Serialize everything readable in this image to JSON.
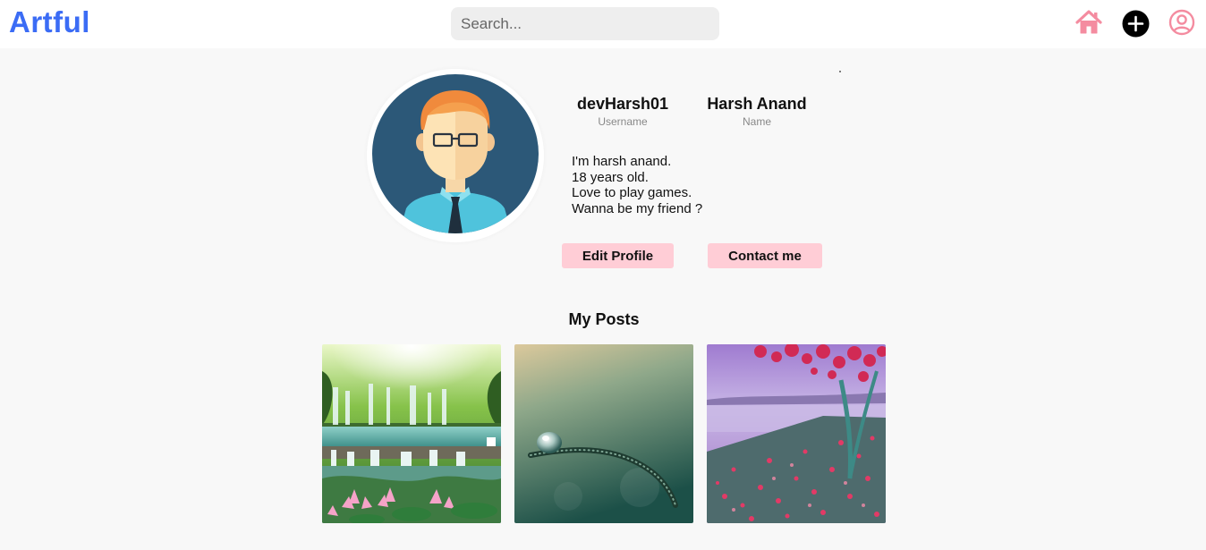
{
  "brand": {
    "name": "Artful",
    "color": "#3b6cf5"
  },
  "search": {
    "placeholder": "Search..."
  },
  "nav": {
    "icons": [
      "home-icon",
      "add-post-icon",
      "profile-icon"
    ],
    "accent": "#f48ca0"
  },
  "profile": {
    "username": "devHarsh01",
    "username_caption": "Username",
    "name": "Harsh Anand",
    "name_caption": "Name",
    "bio": [
      "I'm harsh anand.",
      "18 years old.",
      "Love to play games.",
      "Wanna be my friend ?"
    ],
    "avatar": "avatar-man-with-glasses"
  },
  "actions": {
    "edit_label": "Edit Profile",
    "contact_label": "Contact me",
    "button_color": "#ffcdd6"
  },
  "posts": {
    "title": "My Posts",
    "items": [
      "waterfall-lotus-image",
      "dewdrop-grass-image",
      "autumn-lake-pier-image"
    ]
  }
}
